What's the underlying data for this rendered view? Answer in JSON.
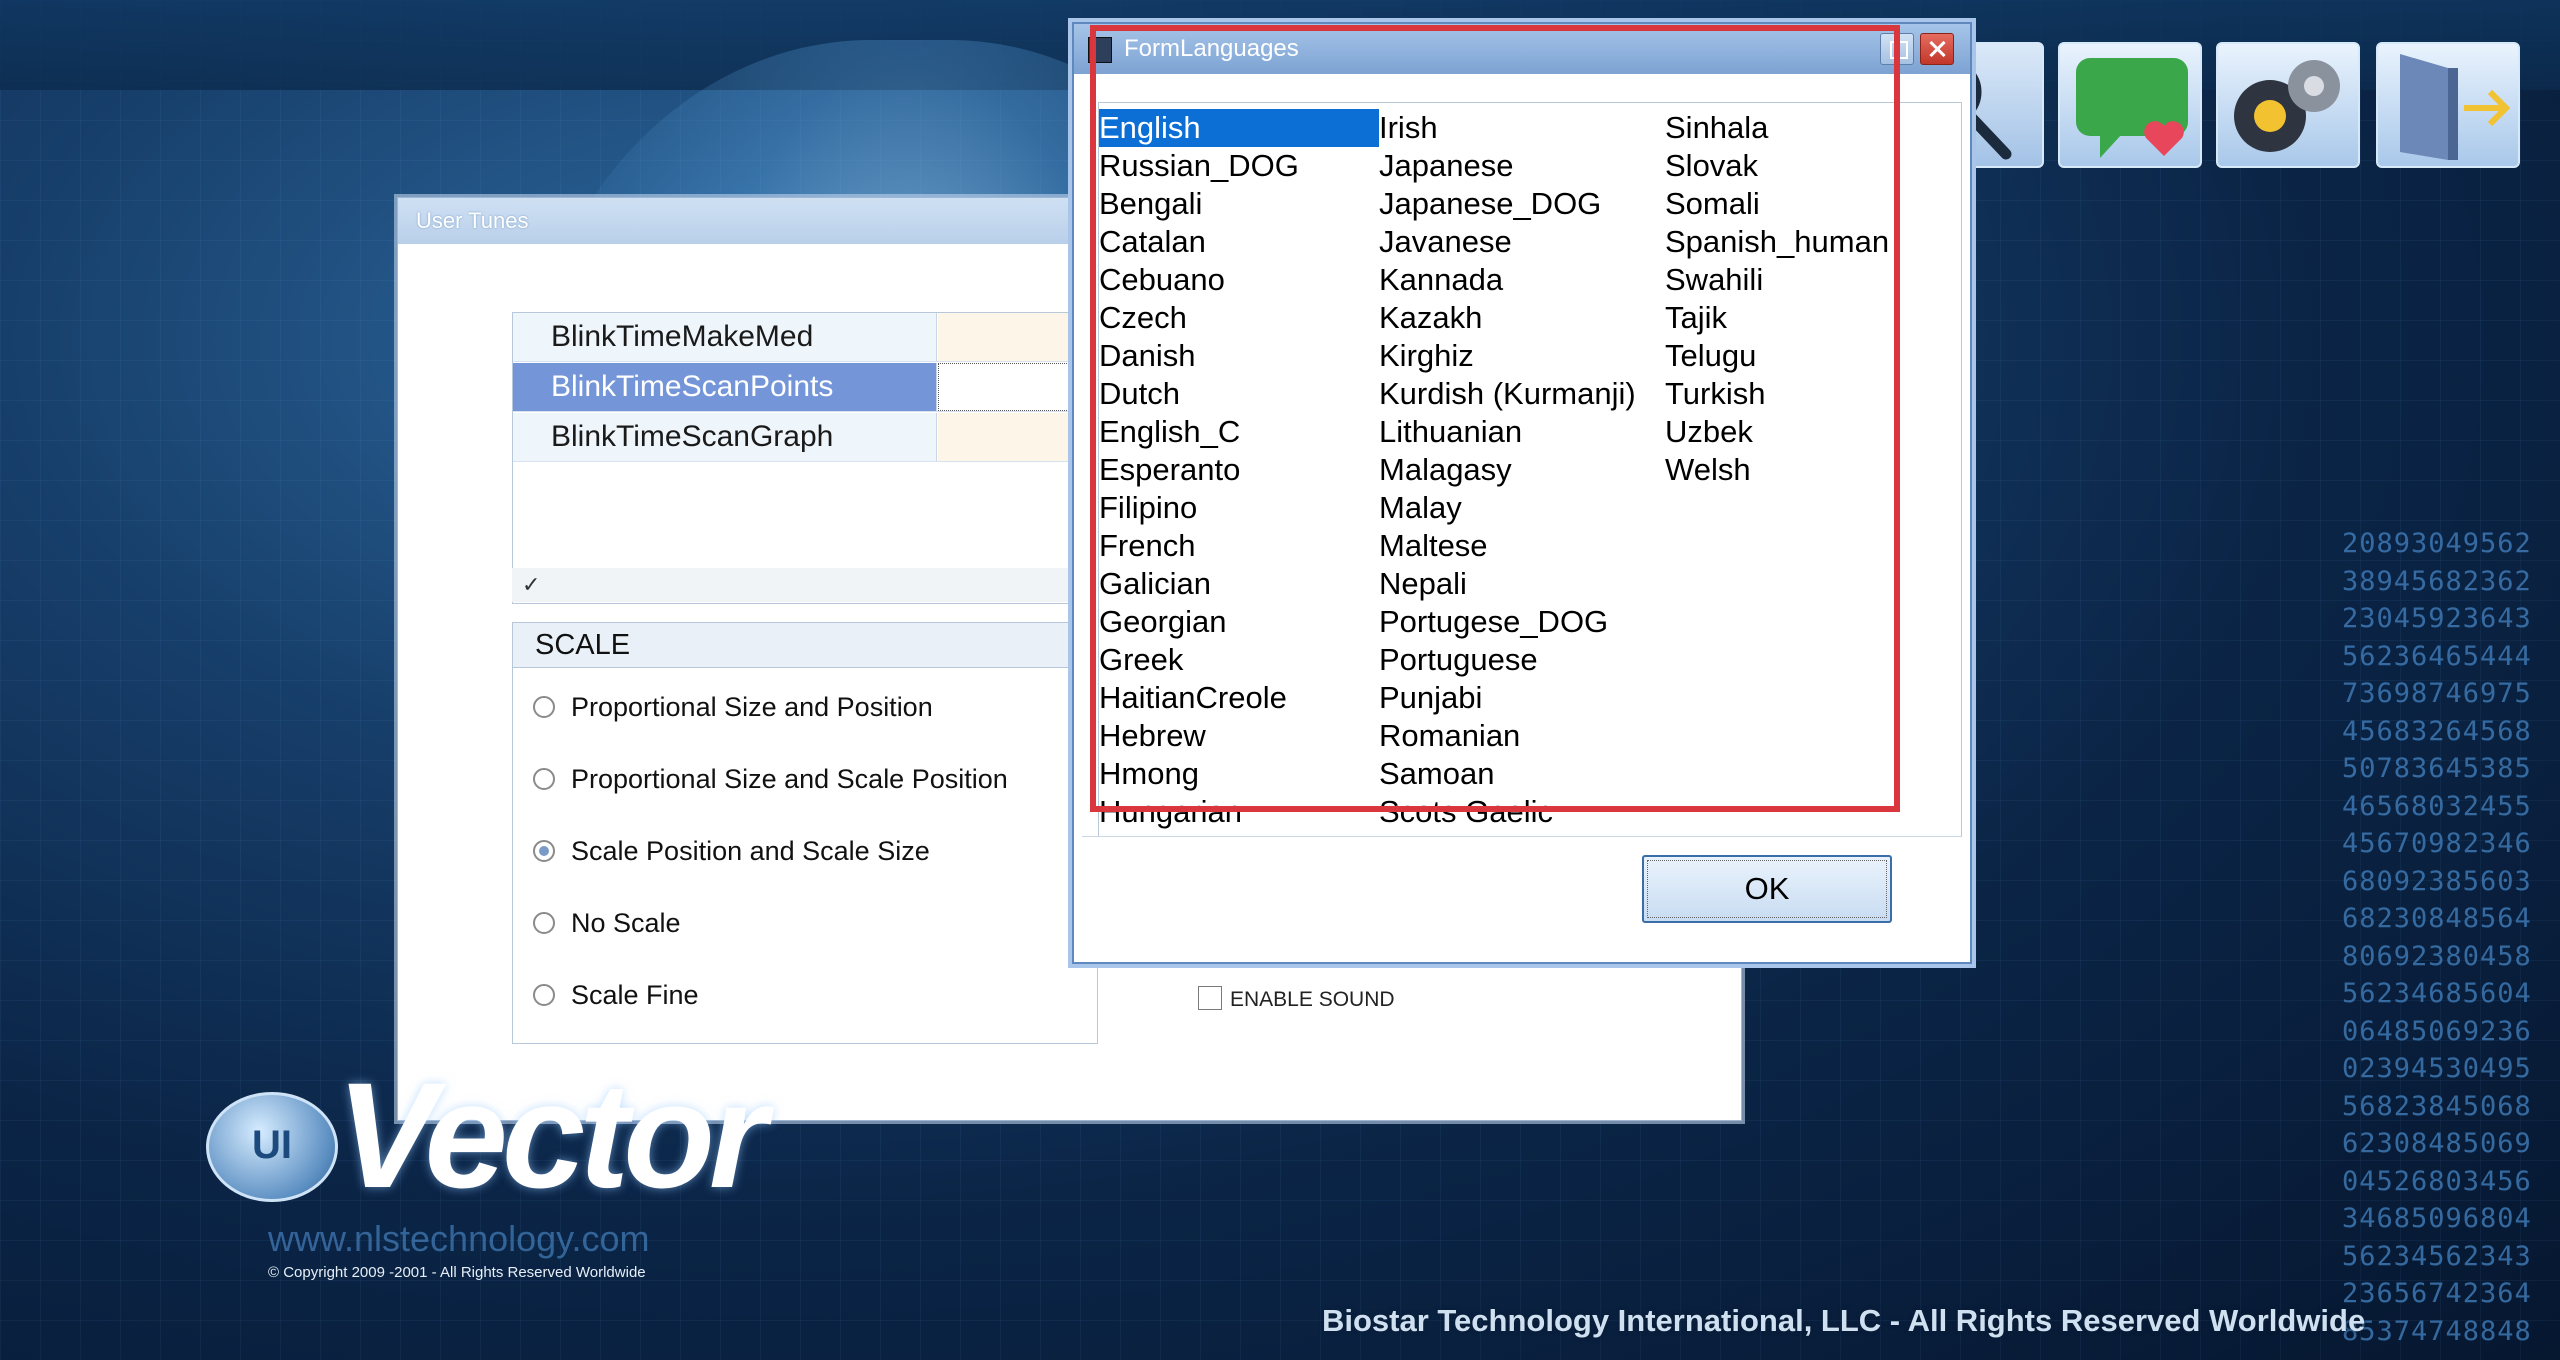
{
  "background": {
    "numbers": [
      "20893049562",
      "38945682362",
      "23045923643",
      "56236465444",
      "73698746975",
      "45683264568",
      "50783645385",
      "46568032455",
      "45670982346",
      "68092385603",
      "68230848564",
      "80692380458",
      "56234685604",
      "06485069236",
      "02394530495",
      "56823845068",
      "62308485069",
      "04526803456",
      "34685096804",
      "56234562343",
      "23656742364",
      "85374748848"
    ]
  },
  "user_tunes": {
    "title": "User Tunes",
    "rows": [
      {
        "name": "BlinkTimeMakeMed",
        "selected": false
      },
      {
        "name": "BlinkTimeScanPoints",
        "selected": true
      },
      {
        "name": "BlinkTimeScanGraph",
        "selected": false
      }
    ],
    "checkmark": "✓",
    "scale": {
      "header": "SCALE",
      "options": [
        {
          "label": "Proportional Size and  Position",
          "checked": false
        },
        {
          "label": "Proportional Size and Scale Position",
          "checked": false
        },
        {
          "label": "Scale Position and  Scale Size",
          "checked": true
        },
        {
          "label": "No Scale",
          "checked": false
        },
        {
          "label": "Scale Fine",
          "checked": false
        }
      ]
    },
    "enable_sound": "ENABLE SOUND"
  },
  "top_icons": [
    "search-icon",
    "chat-heart-icon",
    "gears-icon",
    "exit-door-icon"
  ],
  "form_languages": {
    "title": "FormLanguages",
    "columns": [
      [
        "English",
        "Russian_DOG",
        "Bengali",
        "Catalan",
        "Cebuano",
        "Czech",
        "Danish",
        "Dutch",
        "English_C",
        "Esperanto",
        "Filipino",
        "French",
        "Galician",
        "Georgian",
        "Greek",
        "HaitianCreole",
        "Hebrew",
        "Hmong",
        "Hungarian"
      ],
      [
        "Irish",
        "Japanese",
        "Japanese_DOG",
        "Javanese",
        "Kannada",
        "Kazakh",
        "Kirghiz",
        "Kurdish (Kurmanji)",
        "Lithuanian",
        "Malagasy",
        "Malay",
        "Maltese",
        "Nepali",
        "Portugese_DOG",
        "Portuguese",
        "Punjabi",
        "Romanian",
        "Samoan",
        "Scots Gaelic"
      ],
      [
        "Sinhala",
        "Slovak",
        "Somali",
        "Spanish_human",
        "Swahili",
        "Tajik",
        "Telugu",
        "Turkish",
        "Uzbek",
        "Welsh"
      ]
    ],
    "selected": "English",
    "ok_label": "OK"
  },
  "brand": {
    "badge": "UI",
    "logo_text": "Vector",
    "url": "www.nlstechnology.com",
    "copyright": "© Copyright 2009 -2001 - All Rights Reserved Worldwide",
    "footer": "Biostar Technology International, LLC - All Rights Reserved Worldwide"
  },
  "colors": {
    "selection": "#0b6fd6",
    "highlight_box": "#d9363e",
    "row_selected": "#7496d9"
  }
}
